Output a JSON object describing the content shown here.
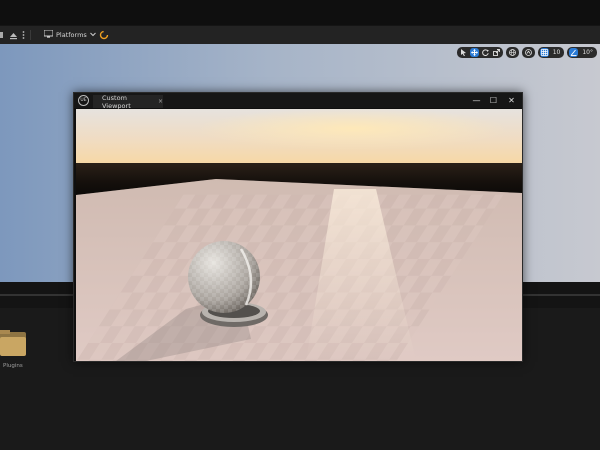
{
  "toolbar": {
    "platforms_label": "Platforms",
    "icons": [
      "grid-icon",
      "eject-icon",
      "kebab-icon",
      "platforms-icon",
      "chevron-down-icon",
      "loading-spinner-icon"
    ]
  },
  "viewport_toolbar": {
    "grid_snap_value": "10",
    "rotation_snap_value": "10°"
  },
  "content_browser": {
    "folder_label": "Plugins"
  },
  "window": {
    "tab_label": "Custom Viewport",
    "tab_close": "×",
    "minimize": "—",
    "maximize": "☐",
    "close": "✕",
    "logo_text": "UE"
  }
}
